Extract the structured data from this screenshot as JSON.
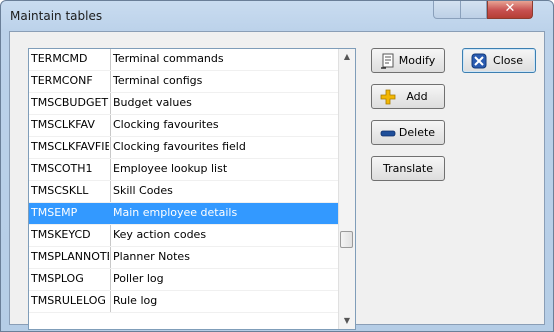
{
  "window": {
    "title": "Maintain tables",
    "close_glyph": "✕"
  },
  "table": {
    "rows": [
      {
        "code": "TERMCMD",
        "description": "Terminal commands"
      },
      {
        "code": "TERMCONF",
        "description": "Terminal configs"
      },
      {
        "code": "TMSCBUDGET",
        "description": "Budget values"
      },
      {
        "code": "TMSCLKFAV",
        "description": "Clocking favourites"
      },
      {
        "code": "TMSCLKFAVFIELD",
        "description": "Clocking favourites field"
      },
      {
        "code": "TMSCOTH1",
        "description": "Employee lookup list"
      },
      {
        "code": "TMSCSKLL",
        "description": "Skill Codes"
      },
      {
        "code": "TMSEMP",
        "description": "Main employee details"
      },
      {
        "code": "TMSKEYCD",
        "description": "Key action codes"
      },
      {
        "code": "TMSPLANNOTE",
        "description": "Planner Notes"
      },
      {
        "code": "TMSPLOG",
        "description": "Poller log"
      },
      {
        "code": "TMSRULELOG",
        "description": "Rule log"
      }
    ],
    "selected_index": 7,
    "scroll_position_fraction": 0.72
  },
  "buttons": {
    "modify": "Modify",
    "add": "Add",
    "delete": "Delete",
    "translate": "Translate",
    "close": "Close"
  },
  "icons": {
    "modify": "document-edit-icon",
    "add": "plus-icon",
    "delete": "minus-icon",
    "close": "close-door-icon"
  },
  "colors": {
    "selection": "#3399ff",
    "dialog_bg": "#f0f0f0"
  }
}
